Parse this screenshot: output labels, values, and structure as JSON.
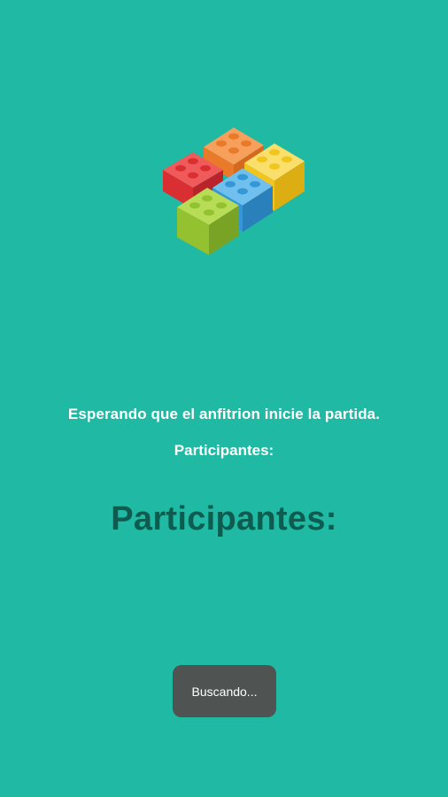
{
  "logo": {
    "icon": "lego-bricks-logo-icon",
    "colors": {
      "red": "#e8383b",
      "orange": "#f58a3c",
      "yellow": "#f7d53a",
      "blue": "#47a8e0",
      "green": "#9fcc3b"
    }
  },
  "status": {
    "waiting_message": "Esperando que el anfitrion inicie la partida.",
    "participants_label_small": "Participantes:",
    "participants_label_large": "Participantes:"
  },
  "toast": {
    "message": "Buscando..."
  },
  "theme": {
    "background": "#20b9a3",
    "heading_color": "#0d5c4f",
    "toast_background": "#4f5452"
  }
}
